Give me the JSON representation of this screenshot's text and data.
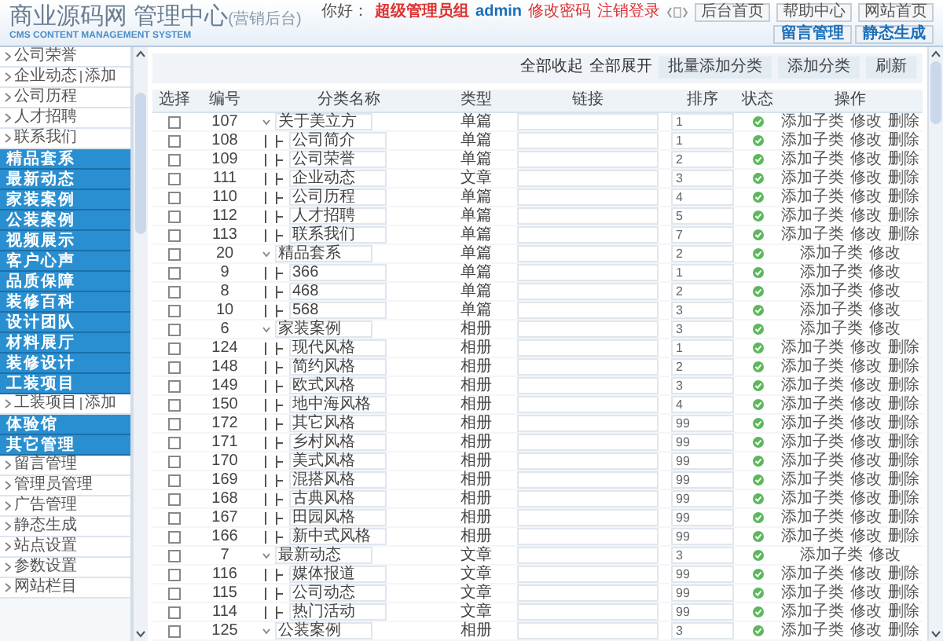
{
  "header": {
    "title": "商业源码网 管理中心",
    "title_note": "(营销后台)",
    "subtitle": "CMS CONTENT MANAGEMENT SYSTEM",
    "greeting": "你好：",
    "role": "超级管理员组",
    "user": "admin",
    "links": [
      "修改密码",
      "注销登录"
    ],
    "buttons": [
      "后台首页",
      "帮助中心",
      "网站首页"
    ],
    "quick_buttons": [
      "留言管理",
      "静态生成"
    ]
  },
  "sidebar": {
    "items": [
      {
        "kind": "sub",
        "label": "公司荣誉"
      },
      {
        "kind": "sub",
        "label": "企业动态",
        "extra": "添加"
      },
      {
        "kind": "sub",
        "label": "公司历程"
      },
      {
        "kind": "sub",
        "label": "人才招聘"
      },
      {
        "kind": "sub",
        "label": "联系我们"
      },
      {
        "kind": "head",
        "label": "精品套系"
      },
      {
        "kind": "head",
        "label": "最新动态"
      },
      {
        "kind": "head",
        "label": "家装案例"
      },
      {
        "kind": "head",
        "label": "公装案例"
      },
      {
        "kind": "head",
        "label": "视频展示"
      },
      {
        "kind": "head",
        "label": "客户心声"
      },
      {
        "kind": "head",
        "label": "品质保障"
      },
      {
        "kind": "head",
        "label": "装修百科"
      },
      {
        "kind": "head",
        "label": "设计团队"
      },
      {
        "kind": "head",
        "label": "材料展厅"
      },
      {
        "kind": "head",
        "label": "装修设计"
      },
      {
        "kind": "head",
        "label": "工装项目"
      },
      {
        "kind": "sub",
        "label": "工装项目",
        "extra": "添加"
      },
      {
        "kind": "head",
        "label": "体验馆"
      },
      {
        "kind": "head",
        "label": "其它管理"
      },
      {
        "kind": "sub",
        "label": "留言管理"
      },
      {
        "kind": "sub",
        "label": "管理员管理"
      },
      {
        "kind": "sub",
        "label": "广告管理"
      },
      {
        "kind": "sub",
        "label": "静态生成"
      },
      {
        "kind": "sub",
        "label": "站点设置"
      },
      {
        "kind": "sub",
        "label": "参数设置"
      },
      {
        "kind": "sub",
        "label": "网站栏目"
      }
    ]
  },
  "toolbar": {
    "links": [
      "全部收起",
      "全部展开"
    ],
    "buttons": [
      "批量添加分类",
      "添加分类",
      "刷新"
    ]
  },
  "table": {
    "columns": [
      "选择",
      "编号",
      "分类名称",
      "类型",
      "链接",
      "排序",
      "状态",
      "操作"
    ],
    "rows": [
      {
        "kind": "parent",
        "checked": false,
        "id": "107",
        "name": "关于美立方",
        "type": "单篇",
        "sort": "1",
        "enabled": true,
        "actions": [
          "添加子类",
          "修改",
          "删除"
        ]
      },
      {
        "kind": "child",
        "checked": false,
        "id": "108",
        "name": "公司简介",
        "type": "单篇",
        "sort": "1",
        "enabled": true,
        "actions": [
          "添加子类",
          "修改",
          "删除"
        ]
      },
      {
        "kind": "child",
        "checked": false,
        "id": "109",
        "name": "公司荣誉",
        "type": "单篇",
        "sort": "2",
        "enabled": true,
        "actions": [
          "添加子类",
          "修改",
          "删除"
        ]
      },
      {
        "kind": "child",
        "checked": false,
        "id": "111",
        "name": "企业动态",
        "type": "文章",
        "sort": "3",
        "enabled": true,
        "actions": [
          "添加子类",
          "修改",
          "删除"
        ]
      },
      {
        "kind": "child",
        "checked": false,
        "id": "110",
        "name": "公司历程",
        "type": "单篇",
        "sort": "4",
        "enabled": true,
        "actions": [
          "添加子类",
          "修改",
          "删除"
        ]
      },
      {
        "kind": "child",
        "checked": false,
        "id": "112",
        "name": "人才招聘",
        "type": "单篇",
        "sort": "5",
        "enabled": true,
        "actions": [
          "添加子类",
          "修改",
          "删除"
        ]
      },
      {
        "kind": "child",
        "checked": false,
        "id": "113",
        "name": "联系我们",
        "type": "单篇",
        "sort": "7",
        "enabled": true,
        "actions": [
          "添加子类",
          "修改",
          "删除"
        ]
      },
      {
        "kind": "parent",
        "checked": false,
        "id": "20",
        "name": "精品套系",
        "type": "单篇",
        "sort": "2",
        "enabled": true,
        "actions": [
          "添加子类",
          "修改"
        ]
      },
      {
        "kind": "child",
        "checked": false,
        "id": "9",
        "name": "366",
        "type": "单篇",
        "sort": "1",
        "enabled": true,
        "actions": [
          "添加子类",
          "修改"
        ]
      },
      {
        "kind": "child",
        "checked": false,
        "id": "8",
        "name": "468",
        "type": "单篇",
        "sort": "2",
        "enabled": true,
        "actions": [
          "添加子类",
          "修改"
        ]
      },
      {
        "kind": "child",
        "checked": false,
        "id": "10",
        "name": "568",
        "type": "单篇",
        "sort": "3",
        "enabled": true,
        "actions": [
          "添加子类",
          "修改"
        ]
      },
      {
        "kind": "parent",
        "checked": false,
        "id": "6",
        "name": "家装案例",
        "type": "相册",
        "sort": "3",
        "enabled": true,
        "actions": [
          "添加子类",
          "修改"
        ]
      },
      {
        "kind": "child",
        "checked": false,
        "id": "124",
        "name": "现代风格",
        "type": "相册",
        "sort": "1",
        "enabled": true,
        "actions": [
          "添加子类",
          "修改",
          "删除"
        ]
      },
      {
        "kind": "child",
        "checked": false,
        "id": "148",
        "name": "简约风格",
        "type": "相册",
        "sort": "2",
        "enabled": true,
        "actions": [
          "添加子类",
          "修改",
          "删除"
        ]
      },
      {
        "kind": "child",
        "checked": false,
        "id": "149",
        "name": "欧式风格",
        "type": "相册",
        "sort": "3",
        "enabled": true,
        "actions": [
          "添加子类",
          "修改",
          "删除"
        ]
      },
      {
        "kind": "child",
        "checked": false,
        "id": "150",
        "name": "地中海风格",
        "type": "相册",
        "sort": "4",
        "enabled": true,
        "actions": [
          "添加子类",
          "修改",
          "删除"
        ]
      },
      {
        "kind": "child",
        "checked": false,
        "id": "172",
        "name": "其它风格",
        "type": "相册",
        "sort": "99",
        "enabled": true,
        "actions": [
          "添加子类",
          "修改",
          "删除"
        ]
      },
      {
        "kind": "child",
        "checked": false,
        "id": "171",
        "name": "乡村风格",
        "type": "相册",
        "sort": "99",
        "enabled": true,
        "actions": [
          "添加子类",
          "修改",
          "删除"
        ]
      },
      {
        "kind": "child",
        "checked": false,
        "id": "170",
        "name": "美式风格",
        "type": "相册",
        "sort": "99",
        "enabled": true,
        "actions": [
          "添加子类",
          "修改",
          "删除"
        ]
      },
      {
        "kind": "child",
        "checked": false,
        "id": "169",
        "name": "混搭风格",
        "type": "相册",
        "sort": "99",
        "enabled": true,
        "actions": [
          "添加子类",
          "修改",
          "删除"
        ]
      },
      {
        "kind": "child",
        "checked": false,
        "id": "168",
        "name": "古典风格",
        "type": "相册",
        "sort": "99",
        "enabled": true,
        "actions": [
          "添加子类",
          "修改",
          "删除"
        ]
      },
      {
        "kind": "child",
        "checked": false,
        "id": "167",
        "name": "田园风格",
        "type": "相册",
        "sort": "99",
        "enabled": true,
        "actions": [
          "添加子类",
          "修改",
          "删除"
        ]
      },
      {
        "kind": "child",
        "checked": false,
        "id": "166",
        "name": "新中式风格",
        "type": "相册",
        "sort": "99",
        "enabled": true,
        "actions": [
          "添加子类",
          "修改",
          "删除"
        ]
      },
      {
        "kind": "parent",
        "checked": false,
        "id": "7",
        "name": "最新动态",
        "type": "文章",
        "sort": "3",
        "enabled": true,
        "actions": [
          "添加子类",
          "修改"
        ]
      },
      {
        "kind": "child",
        "checked": false,
        "id": "116",
        "name": "媒体报道",
        "type": "文章",
        "sort": "99",
        "enabled": true,
        "actions": [
          "添加子类",
          "修改",
          "删除"
        ]
      },
      {
        "kind": "child",
        "checked": false,
        "id": "115",
        "name": "公司动态",
        "type": "文章",
        "sort": "99",
        "enabled": true,
        "actions": [
          "添加子类",
          "修改",
          "删除"
        ]
      },
      {
        "kind": "child",
        "checked": false,
        "id": "114",
        "name": "热门活动",
        "type": "文章",
        "sort": "99",
        "enabled": true,
        "actions": [
          "添加子类",
          "修改",
          "删除"
        ]
      },
      {
        "kind": "parent",
        "checked": false,
        "id": "125",
        "name": "公装案例",
        "type": "相册",
        "sort": "3",
        "enabled": true,
        "actions": [
          "添加子类",
          "修改",
          "删除"
        ]
      }
    ]
  }
}
